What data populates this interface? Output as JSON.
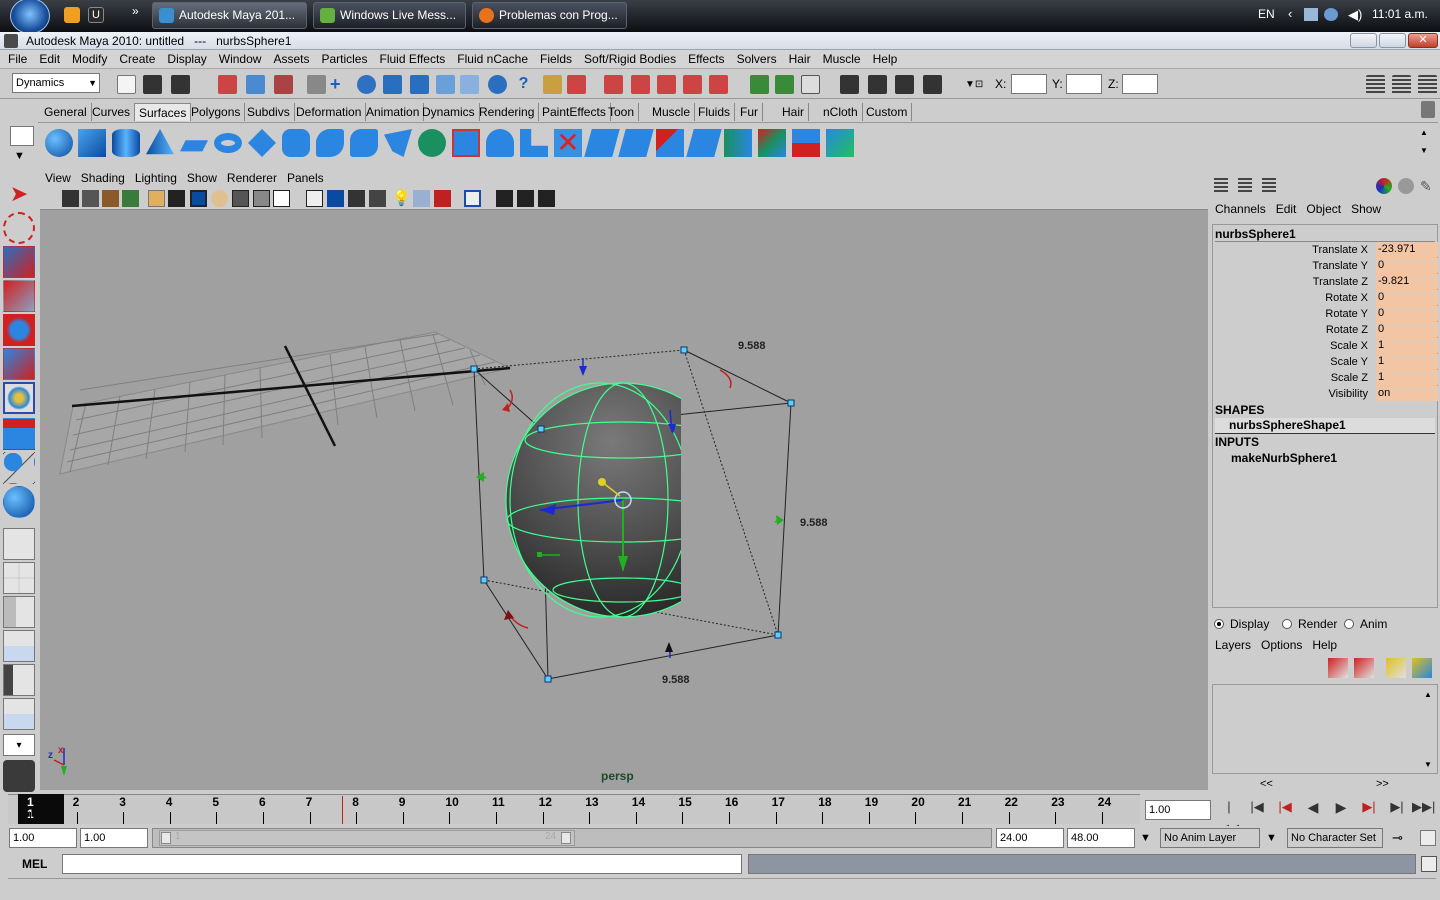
{
  "taskbar": {
    "tasks": [
      "Autodesk Maya 201...",
      "Windows Live Mess...",
      "Problemas con Prog..."
    ],
    "lang": "EN",
    "clock": "11:01 a.m."
  },
  "window": {
    "title": "Autodesk Maya 2010: untitled   ---   nurbsSphere1"
  },
  "menu": [
    "File",
    "Edit",
    "Modify",
    "Create",
    "Display",
    "Window",
    "Assets",
    "Particles",
    "Fluid Effects",
    "Fluid nCache",
    "Fields",
    "Soft/Rigid Bodies",
    "Effects",
    "Solvers",
    "Hair",
    "Muscle",
    "Help"
  ],
  "status": {
    "mode": "Dynamics",
    "x_label": "X:",
    "y_label": "Y:",
    "z_label": "Z:"
  },
  "shelf_tabs": [
    "General",
    "Curves",
    "Surfaces",
    "Polygons",
    "Subdivs",
    "Deformation",
    "Animation",
    "Dynamics",
    "Rendering",
    "PaintEffects",
    "Toon",
    "Muscle",
    "Fluids",
    "Fur",
    "Hair",
    "nCloth",
    "Custom"
  ],
  "shelf_active": "Surfaces",
  "panel_menu": [
    "View",
    "Shading",
    "Lighting",
    "Show",
    "Renderer",
    "Panels"
  ],
  "viewport": {
    "camera": "persp",
    "dim_top": "9.588",
    "dim_right": "9.588",
    "dim_bottom": "9.588",
    "axis_x": "x",
    "axis_z": "z"
  },
  "channel_box": {
    "menu": [
      "Channels",
      "Edit",
      "Object",
      "Show"
    ],
    "object": "nurbsSphere1",
    "attrs": [
      {
        "label": "Translate X",
        "value": "-23.971"
      },
      {
        "label": "Translate Y",
        "value": "0"
      },
      {
        "label": "Translate Z",
        "value": "-9.821"
      },
      {
        "label": "Rotate X",
        "value": "0"
      },
      {
        "label": "Rotate Y",
        "value": "0"
      },
      {
        "label": "Rotate Z",
        "value": "0"
      },
      {
        "label": "Scale X",
        "value": "1"
      },
      {
        "label": "Scale Y",
        "value": "1"
      },
      {
        "label": "Scale Z",
        "value": "1"
      },
      {
        "label": "Visibility",
        "value": "on"
      }
    ],
    "shapes_header": "SHAPES",
    "shape": "nurbsSphereShape1",
    "inputs_header": "INPUTS",
    "input": "makeNurbSphere1"
  },
  "layers": {
    "radios": [
      "Display",
      "Render",
      "Anim"
    ],
    "menu": [
      "Layers",
      "Options",
      "Help"
    ],
    "scroll_left": "<<",
    "scroll_right": ">>"
  },
  "timeline": {
    "frames": [
      "1",
      "2",
      "3",
      "4",
      "5",
      "6",
      "7",
      "8",
      "9",
      "10",
      "11",
      "12",
      "13",
      "14",
      "15",
      "16",
      "17",
      "18",
      "19",
      "20",
      "21",
      "22",
      "23",
      "24"
    ],
    "current_top": "1",
    "current_bottom": "1",
    "current_field": "1.00"
  },
  "range": {
    "start": "1.00",
    "start2": "1.00",
    "end": "24.00",
    "end2": "48.00",
    "slider_start": "1",
    "slider_end": "24",
    "anim_layer": "No Anim Layer",
    "char_set": "No Character Set"
  },
  "cmd": {
    "label": "MEL"
  }
}
